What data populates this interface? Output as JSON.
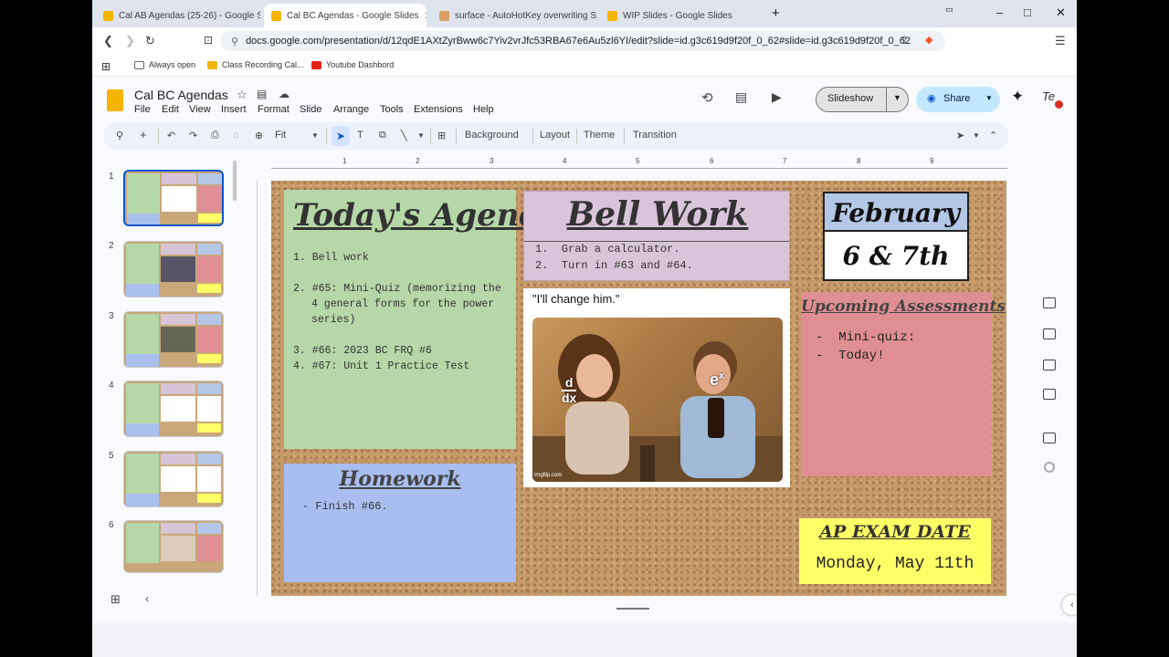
{
  "browser": {
    "tabs": [
      {
        "label": "Cal AB Agendas (25-26) - Google Slid",
        "active": false
      },
      {
        "label": "Cal BC Agendas - Google Slides",
        "active": true
      },
      {
        "label": "surface - AutoHotKey overwriting Su",
        "active": false
      },
      {
        "label": "WIP Slides - Google Slides",
        "active": false
      }
    ],
    "new_tab": "+",
    "url": "docs.google.com/presentation/d/12qdE1AXtZyrBww6c7Yiv2vrJfc53RBA67e6Au5zl6YI/edit?slide=id.g3c619d9f20f_0_62#slide=id.g3c619d9f20f_0_62",
    "bookmarks": [
      "Always open",
      "Class Recording Cal...",
      "Youtube Dashbord"
    ],
    "window_controls": {
      "minimize": "–",
      "maximize": "□",
      "close": "✕"
    }
  },
  "app": {
    "title": "Cal BC Agendas",
    "menus": [
      "File",
      "Edit",
      "View",
      "Insert",
      "Format",
      "Slide",
      "Arrange",
      "Tools",
      "Extensions",
      "Help"
    ],
    "slideshow_label": "Slideshow",
    "share_label": "Share",
    "avatar_text": "Te"
  },
  "toolbar": {
    "zoom": "Fit",
    "background_label": "Background",
    "layout_label": "Layout",
    "theme_label": "Theme",
    "transition_label": "Transition"
  },
  "filmstrip": {
    "slide_numbers": [
      "1",
      "2",
      "3",
      "4",
      "5",
      "6"
    ],
    "selected": 1
  },
  "ruler": {
    "numbers": [
      "1",
      "2",
      "3",
      "4",
      "5",
      "6",
      "7",
      "8",
      "9"
    ]
  },
  "slide": {
    "agenda_title": "Today's Agenda",
    "agenda_items": [
      "1. Bell work",
      "2. #65: Mini-Quiz (memorizing the 4 general forms for the power series)",
      "3. #66: 2023 BC FRQ #6",
      "4. #67: Unit 1 Practice Test"
    ],
    "bell_title": "Bell Work",
    "bell_items": [
      "1.  Grab a calculator.",
      "2.  Turn in #63 and #64."
    ],
    "meme_caption": "\"I'll change him.\"",
    "meme_label_left_num": "d",
    "meme_label_left_den": "dx",
    "meme_label_right": "e",
    "meme_label_right_sup": "x",
    "meme_watermark": "imgflip.com",
    "date_month": "February",
    "date_days": "6 & 7th",
    "assess_title": "Upcoming Assessments",
    "assess_items": [
      "-  Mini-quiz:",
      "-  Today!"
    ],
    "homework_title": "Homework",
    "homework_items": [
      "-  Finish #66."
    ],
    "ap_title": "AP EXAM DATE",
    "ap_date": "Monday, May 11th"
  },
  "colors": {
    "agenda_bg": "#b6d7a8",
    "bell_bg": "#d9c5d9",
    "date_header_bg": "#b4c7e7",
    "assess_bg": "#df8f94",
    "homework_bg": "#a9bef0",
    "ap_bg": "#ffff66",
    "cork": "#c69a6a",
    "accent": "#0b57d0"
  }
}
